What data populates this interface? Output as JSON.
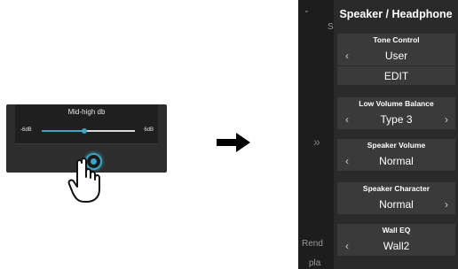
{
  "left_panel": {
    "slider_title": "Mid-high db",
    "min_label": "-6dB",
    "max_label": "6dB",
    "slider_value_fraction": 0.46,
    "accent_color": "#3ea3c4"
  },
  "right_panel": {
    "title": "Speaker / Headphone",
    "sections": [
      {
        "label": "Tone Control",
        "value": "User",
        "has_left": true,
        "has_right": false,
        "action": "EDIT"
      },
      {
        "label": "Low Volume Balance",
        "value": "Type 3",
        "has_left": true,
        "has_right": true
      },
      {
        "label": "Speaker Volume",
        "value": "Normal",
        "has_left": true,
        "has_right": false
      },
      {
        "label": "Speaker Character",
        "value": "Normal",
        "has_left": false,
        "has_right": true
      },
      {
        "label": "Wall EQ",
        "value": "Wall2",
        "has_left": true,
        "has_right": false
      }
    ],
    "background_fragments": [
      "S",
      "Rend",
      "pla"
    ]
  },
  "icons": {
    "arrow": "right-arrow-icon",
    "hand": "tap-hand-icon",
    "chevron_left": "‹",
    "chevron_right": "›",
    "expand": "»"
  }
}
